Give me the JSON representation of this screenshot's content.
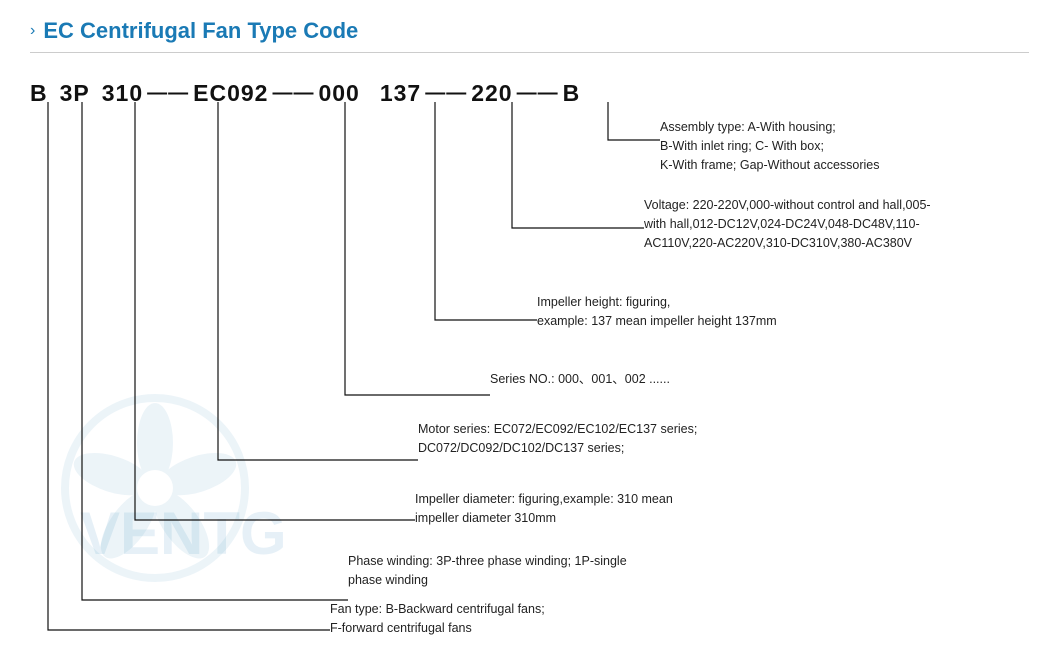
{
  "title": "EC Centrifugal Fan Type Code",
  "title_arrow": "›",
  "code": {
    "b": "B",
    "dash1": "—",
    "p3": "3P",
    "dash2": "—",
    "n310": "310",
    "dash3": "——",
    "ec092": "EC092",
    "dash4": "——",
    "n000": "000",
    "dash5": "—",
    "n137": "137",
    "dash6": "——",
    "n220": "220",
    "dash7": "——",
    "b2": "B"
  },
  "descriptions": {
    "assembly": "Assembly type:  A-With housing;\nB-With inlet ring;  C- With box;\nK-With frame; Gap-Without accessories",
    "voltage": "Voltage:  220-220V,000-without control and hall,005-\nwith hall,012-DC12V,024-DC24V,048-DC48V,110-\nAC110V,220-AC220V,310-DC310V,380-AC380V",
    "impeller_height": "Impeller height:   figuring,\nexample: 137 mean impeller height 137mm",
    "series": "Series NO.:  000、001、002 ......",
    "motor": "Motor series:  EC072/EC092/EC102/EC137 series;\nDC072/DC092/DC102/DC137 series;",
    "impeller_dia": "Impeller diameter:  figuring,example: 310 mean\nimpeller diameter 310mm",
    "phase": "Phase winding:  3P-three phase winding;  1P-single\nphase winding",
    "fan_type": "Fan type:  B-Backward centrifugal fans;\nF-forward centrifugal fans"
  },
  "watermark_text": "VENTG",
  "colors": {
    "blue": "#1a7ab5",
    "line": "#111"
  }
}
